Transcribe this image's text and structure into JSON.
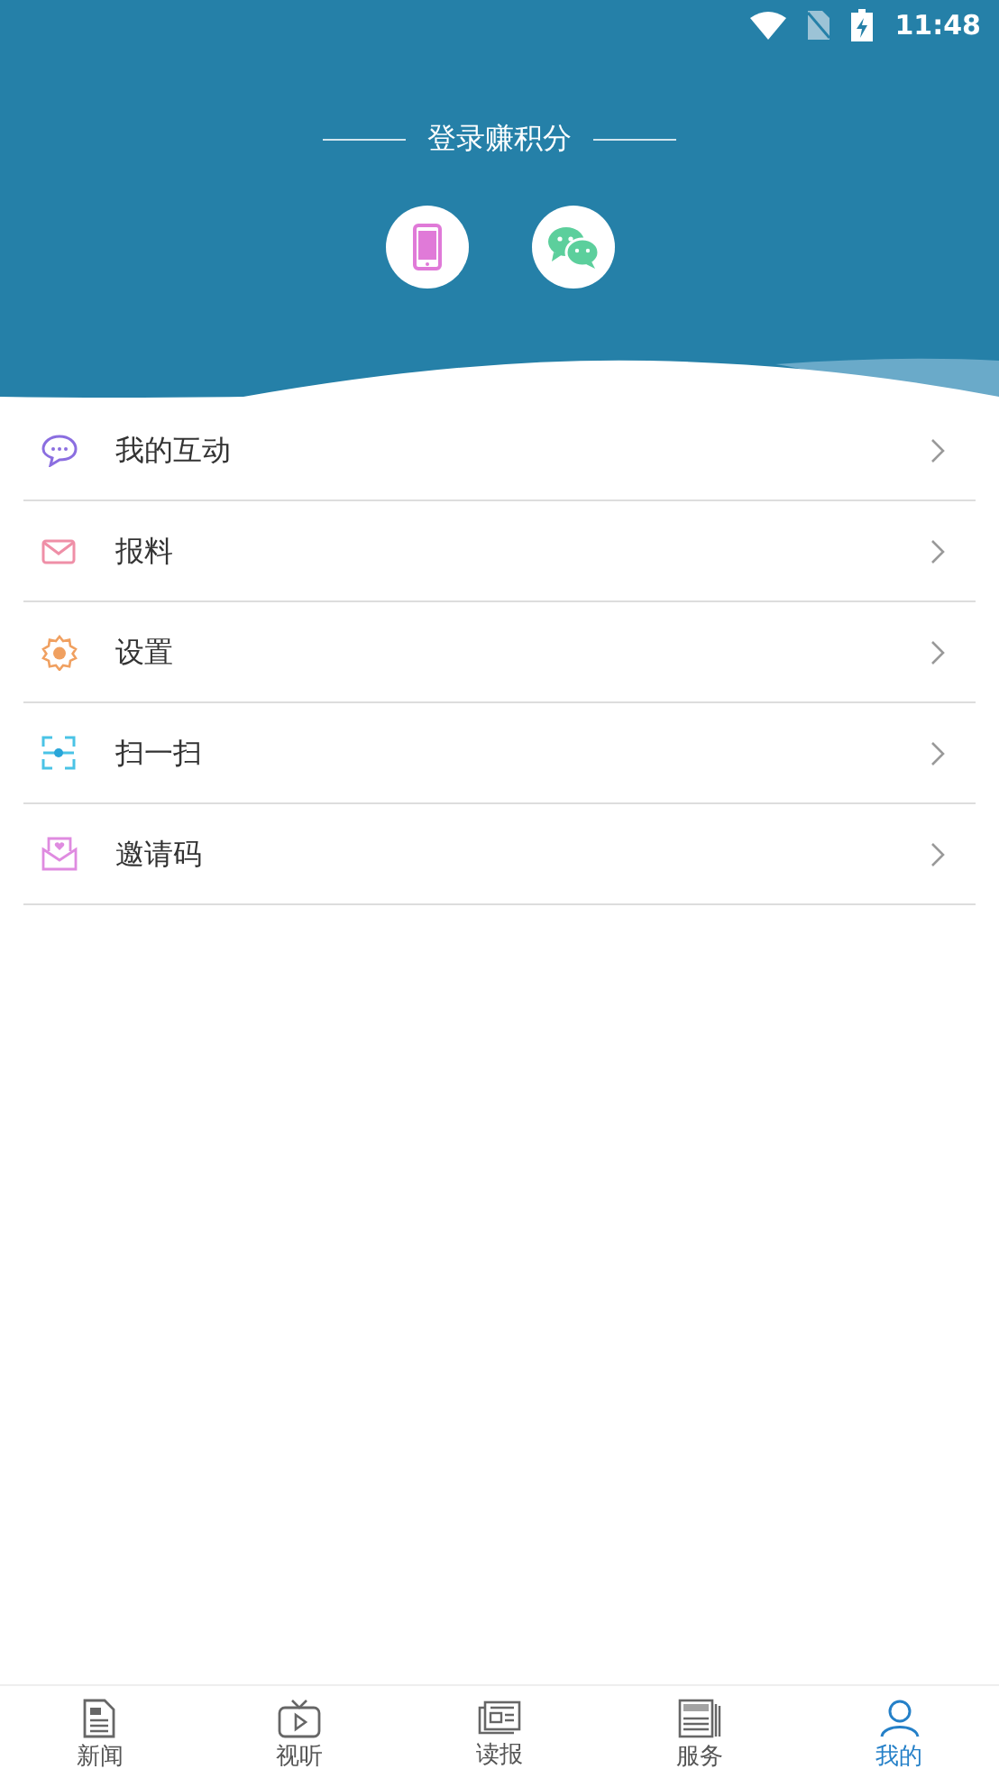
{
  "status_bar": {
    "time": "11:48"
  },
  "login": {
    "title": "登录赚积分",
    "options": [
      {
        "kind": "phone"
      },
      {
        "kind": "wechat"
      }
    ]
  },
  "menu": [
    {
      "kind": "chat",
      "label": "我的互动"
    },
    {
      "kind": "mail",
      "label": "报料"
    },
    {
      "kind": "gear",
      "label": "设置"
    },
    {
      "kind": "scan",
      "label": "扫一扫"
    },
    {
      "kind": "invite",
      "label": "邀请码"
    }
  ],
  "tabs": [
    {
      "kind": "news",
      "label": "新闻",
      "selected": false
    },
    {
      "kind": "tv",
      "label": "视听",
      "selected": false
    },
    {
      "kind": "paper",
      "label": "读报",
      "selected": false
    },
    {
      "kind": "service",
      "label": "服务",
      "selected": false
    },
    {
      "kind": "me",
      "label": "我的",
      "selected": true
    }
  ]
}
